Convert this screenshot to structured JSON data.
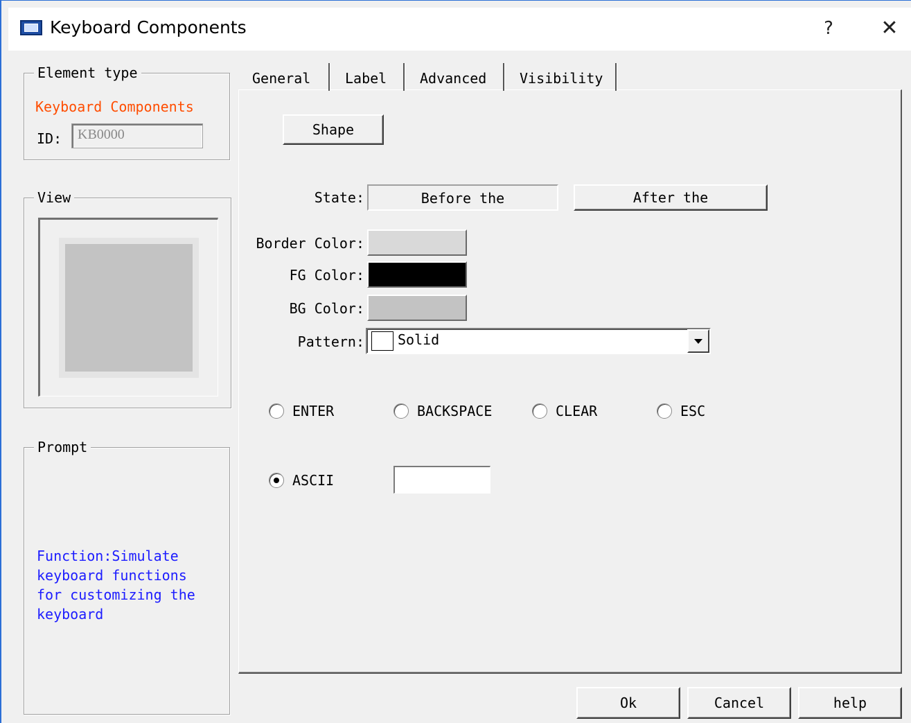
{
  "window": {
    "title": "Keyboard Components",
    "help_symbol": "?",
    "close_symbol": "✕"
  },
  "element_type": {
    "legend": "Element type",
    "type_name": "Keyboard Components",
    "id_label": "ID:",
    "id_value": "KB0000"
  },
  "view": {
    "legend": "View",
    "key_color": "#c3c3c3"
  },
  "prompt": {
    "legend": "Prompt",
    "text": "Function:Simulate\nkeyboard functions\nfor customizing the\nkeyboard"
  },
  "tabs": [
    {
      "label": "General",
      "active": true
    },
    {
      "label": "Label",
      "active": false
    },
    {
      "label": "Advanced",
      "active": false
    },
    {
      "label": "Visibility",
      "active": false
    }
  ],
  "general": {
    "shape_button": "Shape",
    "state_label": "State:",
    "state_before": "Before the",
    "state_after": "After the",
    "border_color_label": "Border Color:",
    "border_color": "#d9d9d9",
    "fg_color_label": "FG Color:",
    "fg_color": "#000000",
    "bg_color_label": "BG Color:",
    "bg_color": "#c3c3c3",
    "pattern_label": "Pattern:",
    "pattern_value": "Solid",
    "key_options": [
      {
        "label": "ENTER",
        "checked": false
      },
      {
        "label": "BACKSPACE",
        "checked": false
      },
      {
        "label": "CLEAR",
        "checked": false
      },
      {
        "label": "ESC",
        "checked": false
      }
    ],
    "ascii_option": {
      "label": "ASCII",
      "checked": true
    },
    "ascii_value": ""
  },
  "footer": {
    "ok": "Ok",
    "cancel": "Cancel",
    "help": "help"
  }
}
